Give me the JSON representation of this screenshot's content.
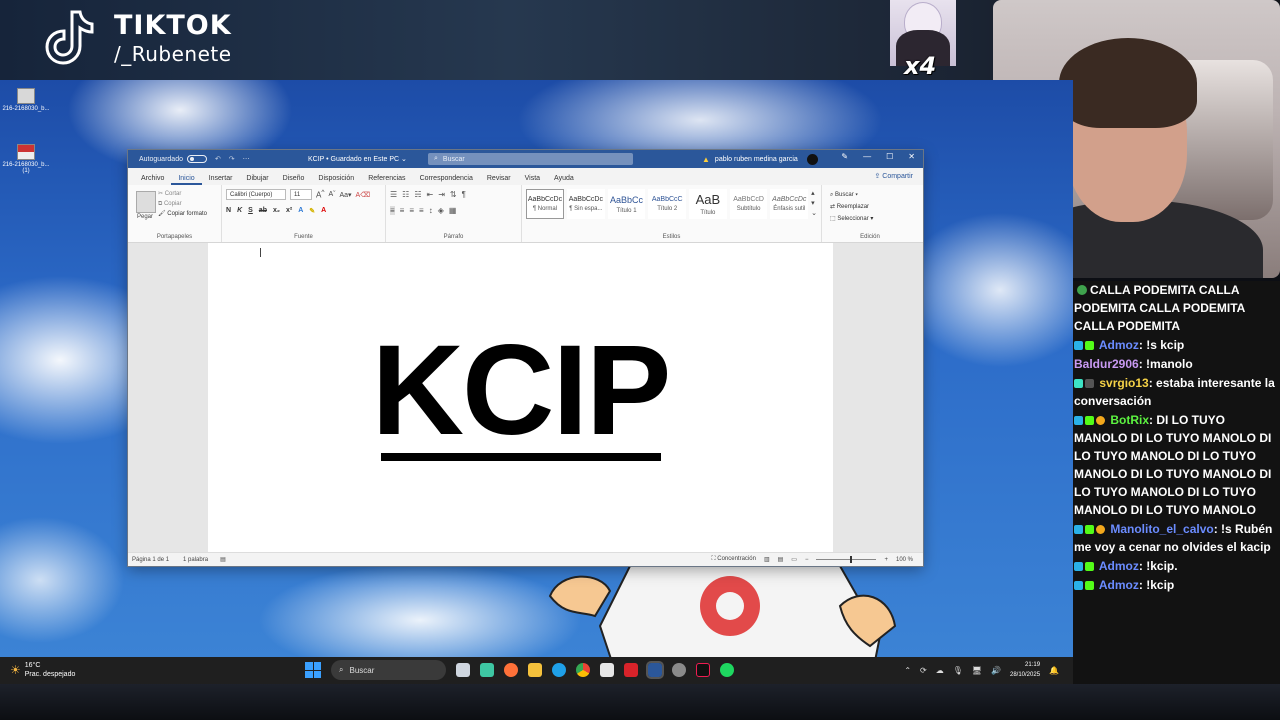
{
  "watermark": {
    "brand": "TIKTOK",
    "handle": "/_Rubenete"
  },
  "overlay": {
    "multiplier": "x4"
  },
  "desktop": {
    "icons": [
      {
        "label": "216-2168030_b..."
      },
      {
        "label": "216-2168030_b... (1)"
      }
    ]
  },
  "word": {
    "autosave_label": "Autoguardado",
    "doc_title": "KCIP • Guardado en Este PC ⌄",
    "search_placeholder": "Buscar",
    "user_name": "pablo ruben medina garcia",
    "tabs": [
      "Archivo",
      "Inicio",
      "Insertar",
      "Dibujar",
      "Diseño",
      "Disposición",
      "Referencias",
      "Correspondencia",
      "Revisar",
      "Vista",
      "Ayuda"
    ],
    "active_tab": "Inicio",
    "share_label": "Compartir",
    "clipboard": {
      "paste": "Pegar",
      "cut": "Cortar",
      "copy": "Copiar",
      "format_painter": "Copiar formato",
      "group": "Portapapeles"
    },
    "font": {
      "name": "Calibri (Cuerpo)",
      "size": "11",
      "group": "Fuente"
    },
    "paragraph": {
      "group": "Párrafo"
    },
    "styles": {
      "group": "Estilos",
      "items": [
        {
          "sample": "AaBbCcDc",
          "label": "¶ Normal"
        },
        {
          "sample": "AaBbCcDc",
          "label": "¶ Sin espa..."
        },
        {
          "sample": "AaBbCc",
          "label": "Título 1"
        },
        {
          "sample": "AaBbCcC",
          "label": "Título 2"
        },
        {
          "sample": "AaB",
          "label": "Título"
        },
        {
          "sample": "AaBbCcD",
          "label": "Subtítulo"
        },
        {
          "sample": "AaBbCcDc",
          "label": "Énfasis sutil"
        }
      ]
    },
    "editing": {
      "find": "Buscar",
      "replace": "Reemplazar",
      "select": "Seleccionar",
      "group": "Edición"
    },
    "document_text": "KCIP",
    "status": {
      "page": "Página 1 de 1",
      "words": "1 palabra",
      "focus": "Concentración",
      "zoom": "100 %"
    }
  },
  "taskbar": {
    "weather_temp": "16°C",
    "weather_desc": "Prac. despejado",
    "search_label": "Buscar",
    "time": "21:19",
    "date": "28/10/2025"
  },
  "chat": {
    "messages": [
      {
        "user": "",
        "text": "CALLA PODEMITA  CALLA PODEMITA  CALLA PODEMITA  CALLA PODEMITA"
      },
      {
        "user": "Admoz",
        "text": ": !s kcip"
      },
      {
        "user": "Baldur2906",
        "text": ": !manolo"
      },
      {
        "user": "svrgio13",
        "text": ": estaba interesante la conversación"
      },
      {
        "user": "BotRix",
        "text": ": DI LO TUYO MANOLO  DI LO TUYO MANOLO  DI LO TUYO MANOLO  DI LO TUYO MANOLO  DI LO TUYO MANOLO  DI LO TUYO MANOLO  DI LO TUYO MANOLO  DI LO TUYO MANOLO"
      },
      {
        "user": "Manolito_el_calvo",
        "text": ": !s Rubén me voy a cenar no olvides el kacip"
      },
      {
        "user": "Admoz",
        "text": ": !kcip."
      },
      {
        "user": "Admoz",
        "text": ": !kcip"
      }
    ]
  }
}
